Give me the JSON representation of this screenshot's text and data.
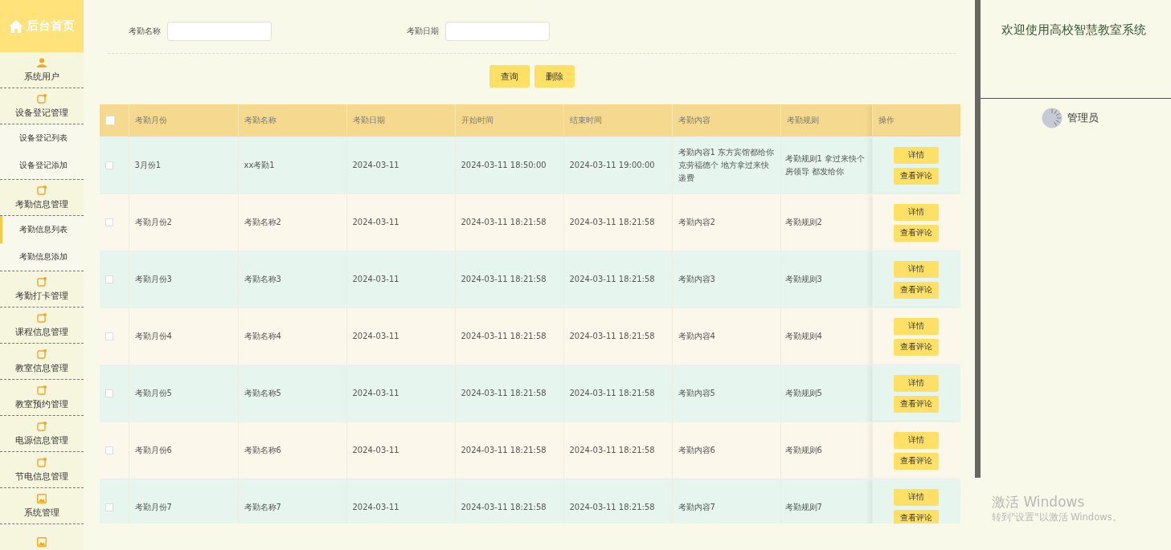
{
  "sidebar": {
    "home": "后台首页",
    "items": [
      {
        "label": "系统用户",
        "kind": "user"
      },
      {
        "label": "设备登记管理",
        "kind": "note",
        "children": [
          {
            "label": "设备登记列表",
            "selected": false
          },
          {
            "label": "设备登记添加",
            "selected": false
          }
        ]
      },
      {
        "label": "考勤信息管理",
        "kind": "note",
        "children": [
          {
            "label": "考勤信息列表",
            "selected": true
          },
          {
            "label": "考勤信息添加",
            "selected": false
          }
        ]
      },
      {
        "label": "考勤打卡管理",
        "kind": "note"
      },
      {
        "label": "课程信息管理",
        "kind": "note"
      },
      {
        "label": "教室信息管理",
        "kind": "note"
      },
      {
        "label": "教室预约管理",
        "kind": "note"
      },
      {
        "label": "电源信息管理",
        "kind": "note"
      },
      {
        "label": "节电信息管理",
        "kind": "note"
      },
      {
        "label": "系统管理",
        "kind": "image"
      },
      {
        "kind": "image"
      }
    ]
  },
  "search": {
    "fields": [
      {
        "label": "考勤名称"
      },
      {
        "label": "考勤日期"
      }
    ],
    "buttons": [
      "查询",
      "删除"
    ]
  },
  "table": {
    "select_all_checked": false,
    "columns": [
      "考勤月份",
      "考勤名称",
      "考勤日期",
      "开始时间",
      "结束时间",
      "考勤内容",
      "考勤规则",
      "操作"
    ],
    "rows": [
      {
        "checked": false,
        "cells": [
          "3月份1",
          "xx考勤1",
          "2024-03-11",
          "2024-03-11 18:50:00",
          "2024-03-11 19:00:00",
          "考勤内容1 东方宾馆都给你克劳福德个 地方拿过来快递费",
          "考勤规则1 拿过来快个房领导 都发给你"
        ],
        "buttons": [
          "详情",
          "查看评论"
        ]
      },
      {
        "checked": false,
        "cells": [
          "考勤月份2",
          "考勤名称2",
          "2024-03-11",
          "2024-03-11 18:21:58",
          "2024-03-11 18:21:58",
          "考勤内容2",
          "考勤规则2"
        ],
        "buttons": [
          "详情",
          "查看评论"
        ]
      },
      {
        "checked": false,
        "cells": [
          "考勤月份3",
          "考勤名称3",
          "2024-03-11",
          "2024-03-11 18:21:58",
          "2024-03-11 18:21:58",
          "考勤内容3",
          "考勤规则3"
        ],
        "buttons": [
          "详情",
          "查看评论"
        ]
      },
      {
        "checked": false,
        "cells": [
          "考勤月份4",
          "考勤名称4",
          "2024-03-11",
          "2024-03-11 18:21:58",
          "2024-03-11 18:21:58",
          "考勤内容4",
          "考勤规则4"
        ],
        "buttons": [
          "详情",
          "查看评论"
        ]
      },
      {
        "checked": false,
        "cells": [
          "考勤月份5",
          "考勤名称5",
          "2024-03-11",
          "2024-03-11 18:21:58",
          "2024-03-11 18:21:58",
          "考勤内容5",
          "考勤规则5"
        ],
        "buttons": [
          "详情",
          "查看评论"
        ]
      },
      {
        "checked": false,
        "cells": [
          "考勤月份6",
          "考勤名称6",
          "2024-03-11",
          "2024-03-11 18:21:58",
          "2024-03-11 18:21:58",
          "考勤内容6",
          "考勤规则6"
        ],
        "buttons": [
          "详情",
          "查看评论"
        ]
      },
      {
        "checked": false,
        "cells": [
          "考勤月份7",
          "考勤名称7",
          "2024-03-11",
          "2024-03-11 18:21:58",
          "2024-03-11 18:21:58",
          "考勤内容7",
          "考勤规则7"
        ],
        "buttons": [
          "详情",
          "查看评论"
        ]
      }
    ]
  },
  "panel": {
    "welcome": "欢迎使用高校智慧教室系统",
    "user": "管理员"
  },
  "activation": {
    "title": "激活 Windows",
    "hint": "转到\"设置\"以激活 Windows。"
  }
}
